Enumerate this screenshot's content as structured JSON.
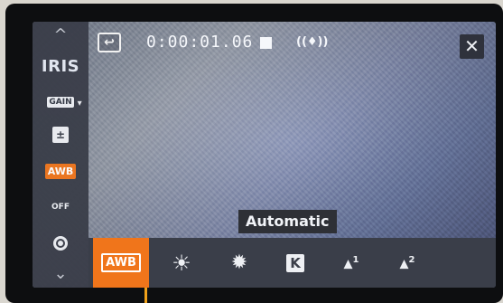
{
  "sidebar": {
    "up_arrow": "^",
    "items": [
      {
        "label": "IRIS"
      },
      {
        "label": "GAIN"
      },
      {
        "label": "±"
      },
      {
        "label": "AWB"
      },
      {
        "label": "OFF"
      },
      {
        "label": ""
      }
    ],
    "down_arrow": "⌄"
  },
  "topbar": {
    "back_label": "↩",
    "timecode": "0:00:01.06",
    "stabilizer_icon": "((♦))",
    "close_label": "✕"
  },
  "wb_mode_label": "Automatic",
  "wb_options": [
    {
      "name": "awb",
      "label": "AWB",
      "selected": true
    },
    {
      "name": "daylight",
      "label": "☀",
      "selected": false
    },
    {
      "name": "tungsten",
      "label": "✹",
      "selected": false
    },
    {
      "name": "kelvin",
      "label": "K",
      "selected": false
    },
    {
      "name": "custom1",
      "label": "1",
      "selected": false
    },
    {
      "name": "custom2",
      "label": "2",
      "selected": false
    }
  ],
  "colors": {
    "accent": "#f0751b",
    "panel": "#3a3e49"
  }
}
